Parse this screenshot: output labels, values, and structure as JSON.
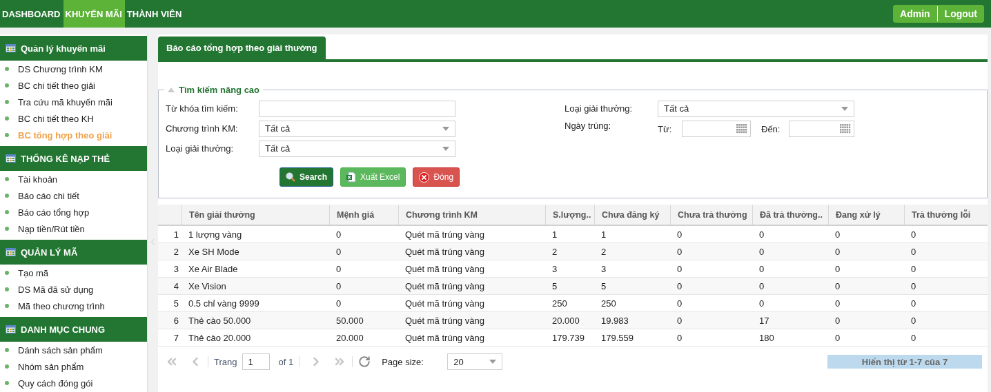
{
  "top_nav": [
    {
      "label": "DASHBOARD",
      "selected": false
    },
    {
      "label": "KHUYẾN MÃI",
      "selected": true
    },
    {
      "label": "THÀNH VIÊN",
      "selected": false
    }
  ],
  "user_menu": [
    "Admin",
    "Logout"
  ],
  "sidebar": [
    {
      "title": "Quản lý khuyến mãi",
      "items": [
        {
          "label": "DS Chương trình KM",
          "selected": false
        },
        {
          "label": "BC chi tiết theo giải",
          "selected": false
        },
        {
          "label": "Tra cứu mã khuyến mãi",
          "selected": false
        },
        {
          "label": "BC chi tiết theo KH",
          "selected": false
        },
        {
          "label": "BC tổng hợp theo giải",
          "selected": true
        }
      ]
    },
    {
      "title": "THỐNG KÊ NẠP THẺ",
      "items": [
        {
          "label": "Tài khoản",
          "selected": false
        },
        {
          "label": "Báo cáo chi tiết",
          "selected": false
        },
        {
          "label": "Báo cáo tổng hợp",
          "selected": false
        },
        {
          "label": "Nạp tiền/Rút tiền",
          "selected": false
        }
      ]
    },
    {
      "title": "QUẢN LÝ MÃ",
      "items": [
        {
          "label": "Tạo mã",
          "selected": false
        },
        {
          "label": "DS Mã đã sử dụng",
          "selected": false
        },
        {
          "label": "Mã theo chương trình",
          "selected": false
        }
      ]
    },
    {
      "title": "DANH MỤC CHUNG",
      "items": [
        {
          "label": "Dánh sách sản phẩm",
          "selected": false
        },
        {
          "label": "Nhóm sản phẩm",
          "selected": false
        },
        {
          "label": "Quy cách đóng gói",
          "selected": false
        }
      ]
    }
  ],
  "page_tab": "Báo cáo tổng hợp theo giải thưởng",
  "search_panel": {
    "legend": "Tìm kiếm nâng cao",
    "left_fields": [
      {
        "kind": "text",
        "label": "Từ khóa tìm kiếm:"
      },
      {
        "kind": "select",
        "label": "Chương trình KM:",
        "value": "Tất cả"
      },
      {
        "kind": "select",
        "label": "Loại giải thưởng:",
        "value": "Tất cả"
      }
    ],
    "right_fields": [
      {
        "kind": "select",
        "label": "Loại giải thưởng:",
        "value": "Tất cả"
      }
    ],
    "date": {
      "label": "Ngày trúng:",
      "from_label": "Từ:",
      "to_label": "Đến:"
    },
    "buttons": [
      {
        "kind": "search",
        "label": "Search"
      },
      {
        "kind": "excel",
        "label": "Xuất Excel"
      },
      {
        "kind": "close",
        "label": "Đóng"
      }
    ]
  },
  "table": {
    "columns": [
      "",
      "Tên giải thưởng",
      "Mệnh giá",
      "Chương trình KM",
      "S.lượng..",
      "Chưa đăng ký",
      "Chưa trả thưởng",
      "Đã trả thưởng..",
      "Đang xử lý",
      "Trả thưởng lỗi"
    ],
    "rows": [
      [
        "1",
        "1 lượng vàng",
        "0",
        "Quét mã trúng vàng",
        "1",
        "1",
        "0",
        "0",
        "0",
        "0"
      ],
      [
        "2",
        "Xe SH Mode",
        "0",
        "Quét mã trúng vàng",
        "2",
        "2",
        "0",
        "0",
        "0",
        "0"
      ],
      [
        "3",
        "Xe Air Blade",
        "0",
        "Quét mã trúng vàng",
        "3",
        "3",
        "0",
        "0",
        "0",
        "0"
      ],
      [
        "4",
        "Xe Vision",
        "0",
        "Quét mã trúng vàng",
        "5",
        "5",
        "0",
        "0",
        "0",
        "0"
      ],
      [
        "5",
        "0.5 chỉ vàng 9999",
        "0",
        "Quét mã trúng vàng",
        "250",
        "250",
        "0",
        "0",
        "0",
        "0"
      ],
      [
        "6",
        "Thẻ cào 50.000",
        "50.000",
        "Quét mã trúng vàng",
        "20.000",
        "19.983",
        "0",
        "17",
        "0",
        "0"
      ],
      [
        "7",
        "Thẻ cào 20.000",
        "20.000",
        "Quét mã trúng vàng",
        "179.739",
        "179.559",
        "0",
        "180",
        "0",
        "0"
      ]
    ]
  },
  "pager": {
    "first_disabled": true,
    "prev_disabled": true,
    "next_disabled": true,
    "last_disabled": true,
    "page_label": "Trang",
    "page": "1",
    "of": "of 1",
    "size_label": "Page size:",
    "size": "20",
    "summary": "Hiển thị từ 1-7 của 7"
  }
}
